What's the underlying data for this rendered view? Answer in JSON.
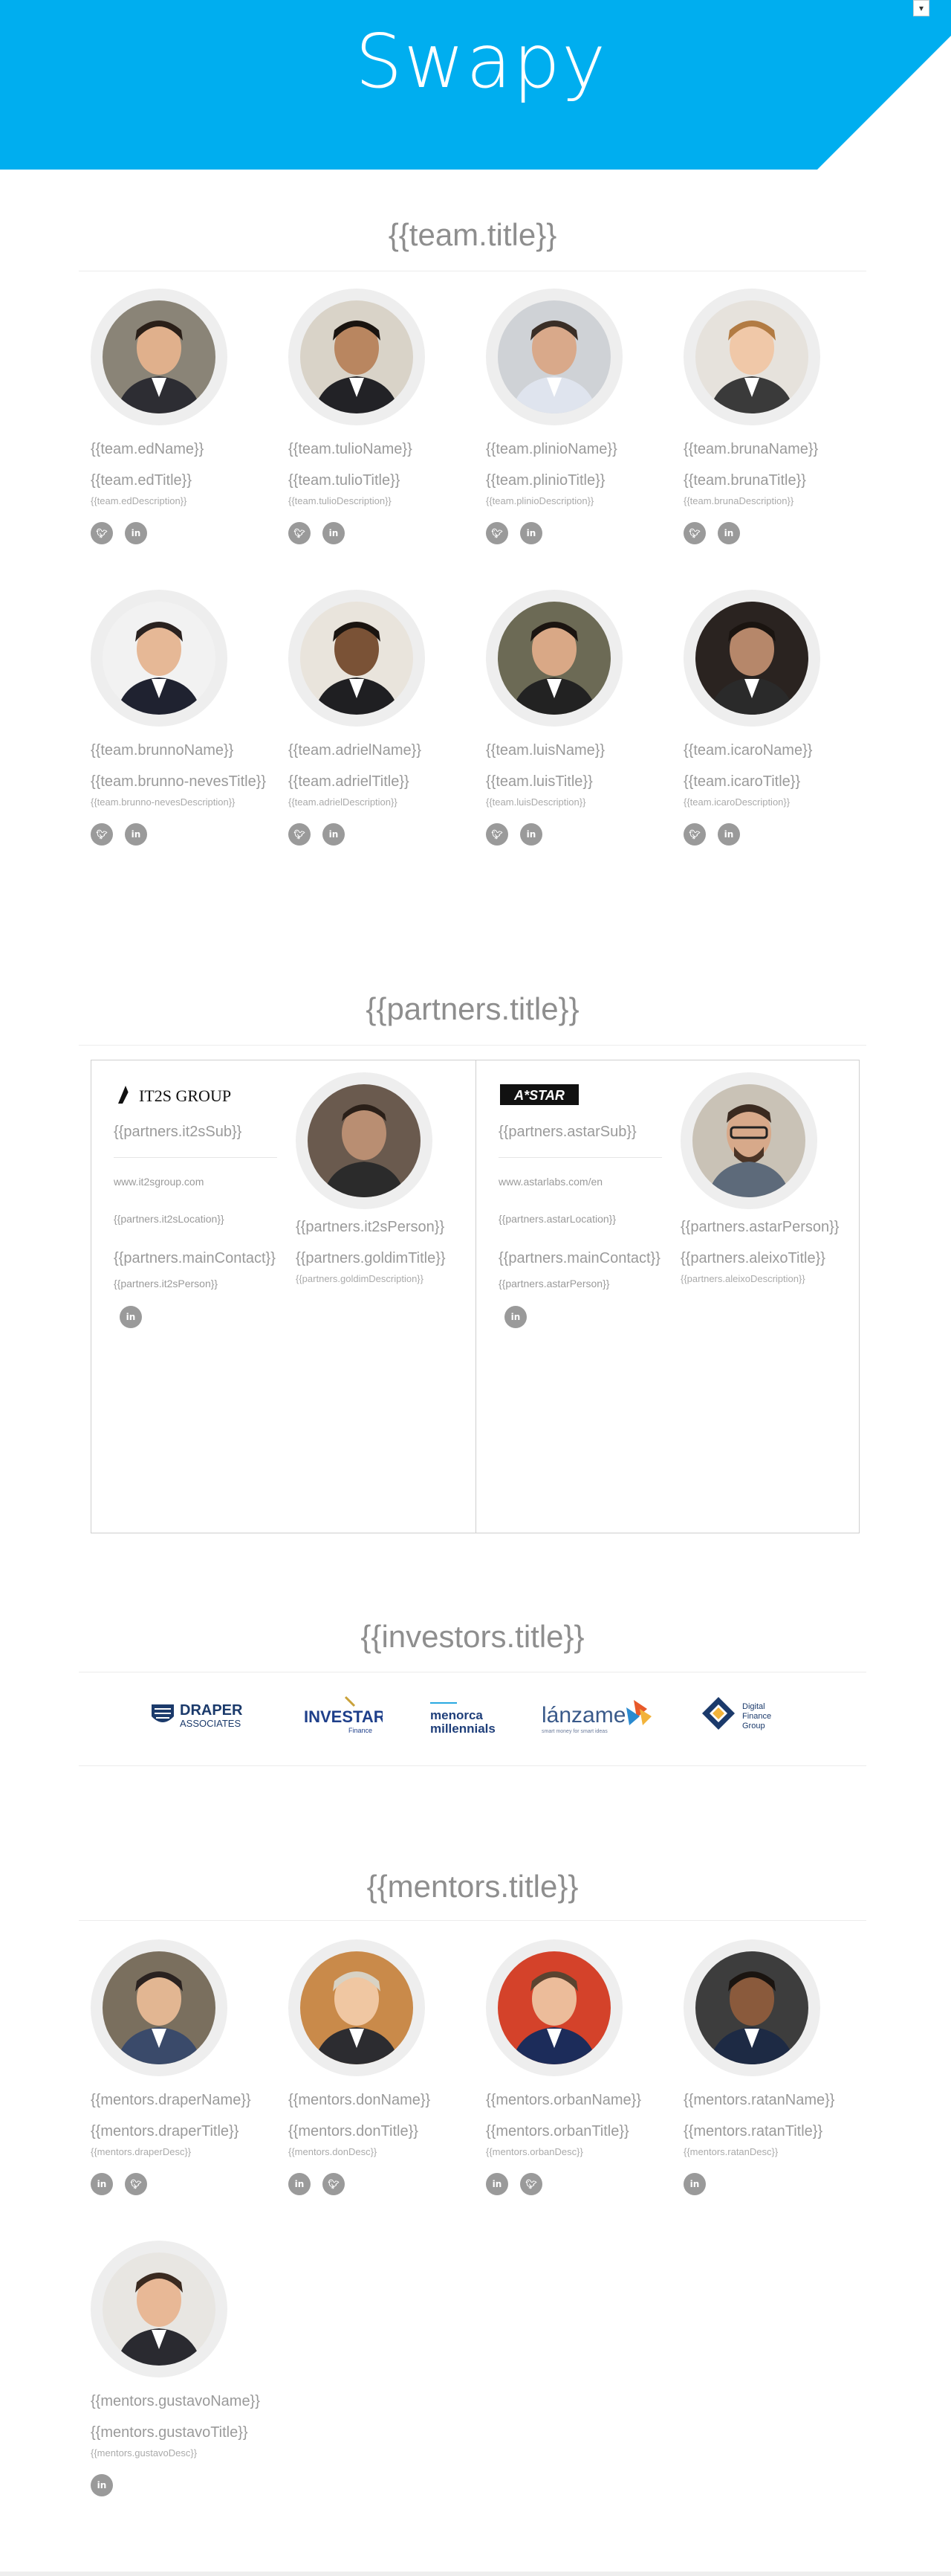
{
  "header": {
    "brand_color": "#00aeef",
    "logo_text": "Swapy",
    "lang_toggle": "▾"
  },
  "team": {
    "title": "{{team.title}}",
    "members": [
      {
        "name": "{{team.edName}}",
        "title": "{{team.edTitle}}",
        "desc": "{{team.edDescription}}",
        "socials": [
          "twitter-icon",
          "linkedin-icon"
        ]
      },
      {
        "name": "{{team.tulioName}}",
        "title": "{{team.tulioTitle}}",
        "desc": "{{team.tulioDescription}}",
        "socials": [
          "twitter-icon",
          "linkedin-icon"
        ]
      },
      {
        "name": "{{team.plinioName}}",
        "title": "{{team.plinioTitle}}",
        "desc": "{{team.plinioDescription}}",
        "socials": [
          "twitter-icon",
          "linkedin-icon"
        ]
      },
      {
        "name": "{{team.brunaName}}",
        "title": "{{team.brunaTitle}}",
        "desc": "{{team.brunaDescription}}",
        "socials": [
          "twitter-icon",
          "linkedin-icon"
        ]
      },
      {
        "name": "{{team.brunnoName}}",
        "title": "{{team.brunno-nevesTitle}}",
        "desc": "{{team.brunno-nevesDescription}}",
        "socials": [
          "twitter-icon",
          "linkedin-icon"
        ]
      },
      {
        "name": "{{team.adrielName}}",
        "title": "{{team.adrielTitle}}",
        "desc": "{{team.adrielDescription}}",
        "socials": [
          "twitter-icon",
          "linkedin-icon"
        ]
      },
      {
        "name": "{{team.luisName}}",
        "title": "{{team.luisTitle}}",
        "desc": "{{team.luisDescription}}",
        "socials": [
          "twitter-icon",
          "linkedin-icon"
        ]
      },
      {
        "name": "{{team.icaroName}}",
        "title": "{{team.icaroTitle}}",
        "desc": "{{team.icaroDescription}}",
        "socials": [
          "twitter-icon",
          "linkedin-icon"
        ]
      }
    ]
  },
  "partners": {
    "title": "{{partners.title}}",
    "items": [
      {
        "logo_text": "IT2S GROUP",
        "sub": "{{partners.it2sSub}}",
        "url": "www.it2sgroup.com",
        "location": "{{partners.it2sLocation}}",
        "main_contact": "{{partners.mainContact}}",
        "contact_person": "{{partners.it2sPerson}}",
        "person_name": "{{partners.it2sPerson}}",
        "person_title": "{{partners.goldimTitle}}",
        "person_desc": "{{partners.goldimDescription}}"
      },
      {
        "logo_text": "A*STAR",
        "sub": "{{partners.astarSub}}",
        "url": "www.astarlabs.com/en",
        "location": "{{partners.astarLocation}}",
        "main_contact": "{{partners.mainContact}}",
        "contact_person": "{{partners.astarPerson}}",
        "person_name": "{{partners.astarPerson}}",
        "person_title": "{{partners.aleixoTitle}}",
        "person_desc": "{{partners.aleixoDescription}}"
      }
    ]
  },
  "investors": {
    "title": "{{investors.title}}",
    "logos": [
      {
        "line1": "DRAPER",
        "line2": "ASSOCIATES"
      },
      {
        "line1": "INVESTAR",
        "line2": "Finance"
      },
      {
        "line1": "menorca",
        "line2": "millennials"
      },
      {
        "line1": "lánzame",
        "line2": "smart money for smart ideas"
      },
      {
        "line1": "Digital",
        "line2": "Finance",
        "line3": "Group"
      }
    ]
  },
  "mentors": {
    "title": "{{mentors.title}}",
    "members": [
      {
        "name": "{{mentors.draperName}}",
        "title": "{{mentors.draperTitle}}",
        "desc": "{{mentors.draperDesc}}",
        "socials": [
          "linkedin-icon",
          "twitter-icon"
        ]
      },
      {
        "name": "{{mentors.donName}}",
        "title": "{{mentors.donTitle}}",
        "desc": "{{mentors.donDesc}}",
        "socials": [
          "linkedin-icon",
          "twitter-icon"
        ]
      },
      {
        "name": "{{mentors.orbanName}}",
        "title": "{{mentors.orbanTitle}}",
        "desc": "{{mentors.orbanDesc}}",
        "socials": [
          "linkedin-icon",
          "twitter-icon"
        ]
      },
      {
        "name": "{{mentors.ratanName}}",
        "title": "{{mentors.ratanTitle}}",
        "desc": "{{mentors.ratanDesc}}",
        "socials": [
          "linkedin-icon"
        ]
      },
      {
        "name": "{{mentors.gustavoName}}",
        "title": "{{mentors.gustavoTitle}}",
        "desc": "{{mentors.gustavoDesc}}",
        "socials": [
          "linkedin-icon"
        ]
      }
    ]
  }
}
